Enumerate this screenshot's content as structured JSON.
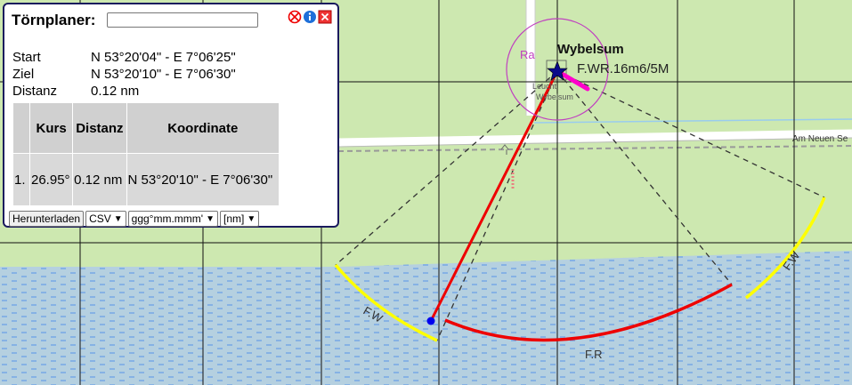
{
  "panel": {
    "title": "Törnplaner:",
    "name_value": "",
    "icons": [
      "delete-icon",
      "info-icon",
      "close-icon"
    ],
    "start_label": "Start",
    "start_value": "N 53°20'04\" - E 7°06'25\"",
    "target_label": "Ziel",
    "target_value": "N 53°20'10\" - E 7°06'30\"",
    "distance_label": "Distanz",
    "distance_value": "0.12 nm",
    "table": {
      "headers": [
        "",
        "Kurs",
        "Distanz",
        "Koordinate"
      ],
      "rows": [
        {
          "index": "1.",
          "course": "26.95°",
          "distance": "0.12 nm",
          "coordinate": "N 53°20'10\" - E 7°06'30\""
        }
      ]
    },
    "download_label": "Herunterladen",
    "format_selected": "CSV",
    "coord_format_selected": "ggg°mm.mmm'",
    "unit_selected": "[nm]"
  },
  "map": {
    "place_label": "Wybelsum",
    "light_label": "F.WR.16m6/5M",
    "radar_label": "Ra",
    "beacon_label_1": "Leucht",
    "beacon_label_2": "Wybelsum",
    "street_label": "Am Neuen Se",
    "sector_label_white_left": "F.W",
    "sector_label_red": "F.R",
    "sector_label_white_right": "F.W",
    "colors": {
      "land": "#cde8b0",
      "water": "#b5d0e0",
      "route": "#ee0000",
      "sector_white": "#ffff00",
      "sector_red": "#ee0000",
      "radar": "#c040c0",
      "grid": "#111111"
    }
  }
}
